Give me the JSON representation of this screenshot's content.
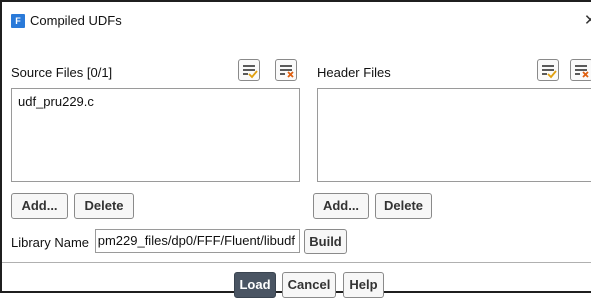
{
  "window": {
    "title": "Compiled UDFs",
    "app_icon_letter": "F"
  },
  "source_files": {
    "label": "Source Files [0/1]",
    "items": [
      "udf_pru229.c"
    ],
    "add_label": "Add...",
    "delete_label": "Delete"
  },
  "header_files": {
    "label": "Header Files",
    "items": [],
    "add_label": "Add...",
    "delete_label": "Delete"
  },
  "library": {
    "label": "Library Name",
    "value": "pm229_files/dp0/FFF/Fluent/libudf",
    "build_label": "Build"
  },
  "footer": {
    "load_label": "Load",
    "cancel_label": "Cancel",
    "help_label": "Help"
  },
  "icons": {
    "select_all": "select-all-icon",
    "deselect_all": "deselect-all-icon",
    "close": "close-icon"
  },
  "colors": {
    "accent": "#2a7ad9",
    "primary_button": "#4a5563",
    "check": "#e0a010",
    "cross": "#e06010"
  }
}
